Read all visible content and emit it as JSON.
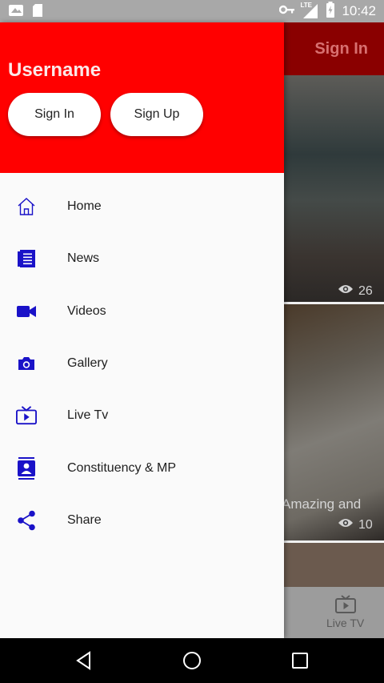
{
  "status_bar": {
    "time": "10:42",
    "network_label": "LTE",
    "icons": [
      "notification-icon",
      "sd-card-icon",
      "key-icon",
      "signal-icon",
      "battery-icon"
    ]
  },
  "background": {
    "toolbar_action": "Sign In",
    "card1_views": "26",
    "card2_caption": "Amazing and",
    "card2_views": "10",
    "bottom_nav_label": "Live TV",
    "colors": {
      "toolbar": "#8a0000"
    }
  },
  "drawer": {
    "username": "Username",
    "sign_in_label": "Sign In",
    "sign_up_label": "Sign Up",
    "colors": {
      "header": "#ff0000",
      "icon": "#1a12c8"
    },
    "items": [
      {
        "label": "Home",
        "icon": "home-icon"
      },
      {
        "label": "News",
        "icon": "news-icon"
      },
      {
        "label": "Videos",
        "icon": "video-camera-icon"
      },
      {
        "label": "Gallery",
        "icon": "camera-icon"
      },
      {
        "label": "Live Tv",
        "icon": "tv-icon"
      },
      {
        "label": "Constituency & MP",
        "icon": "contact-card-icon"
      },
      {
        "label": "Share",
        "icon": "share-icon"
      }
    ]
  },
  "nav_bar": {
    "buttons": [
      "back-icon",
      "home-circle-icon",
      "recents-icon"
    ]
  }
}
